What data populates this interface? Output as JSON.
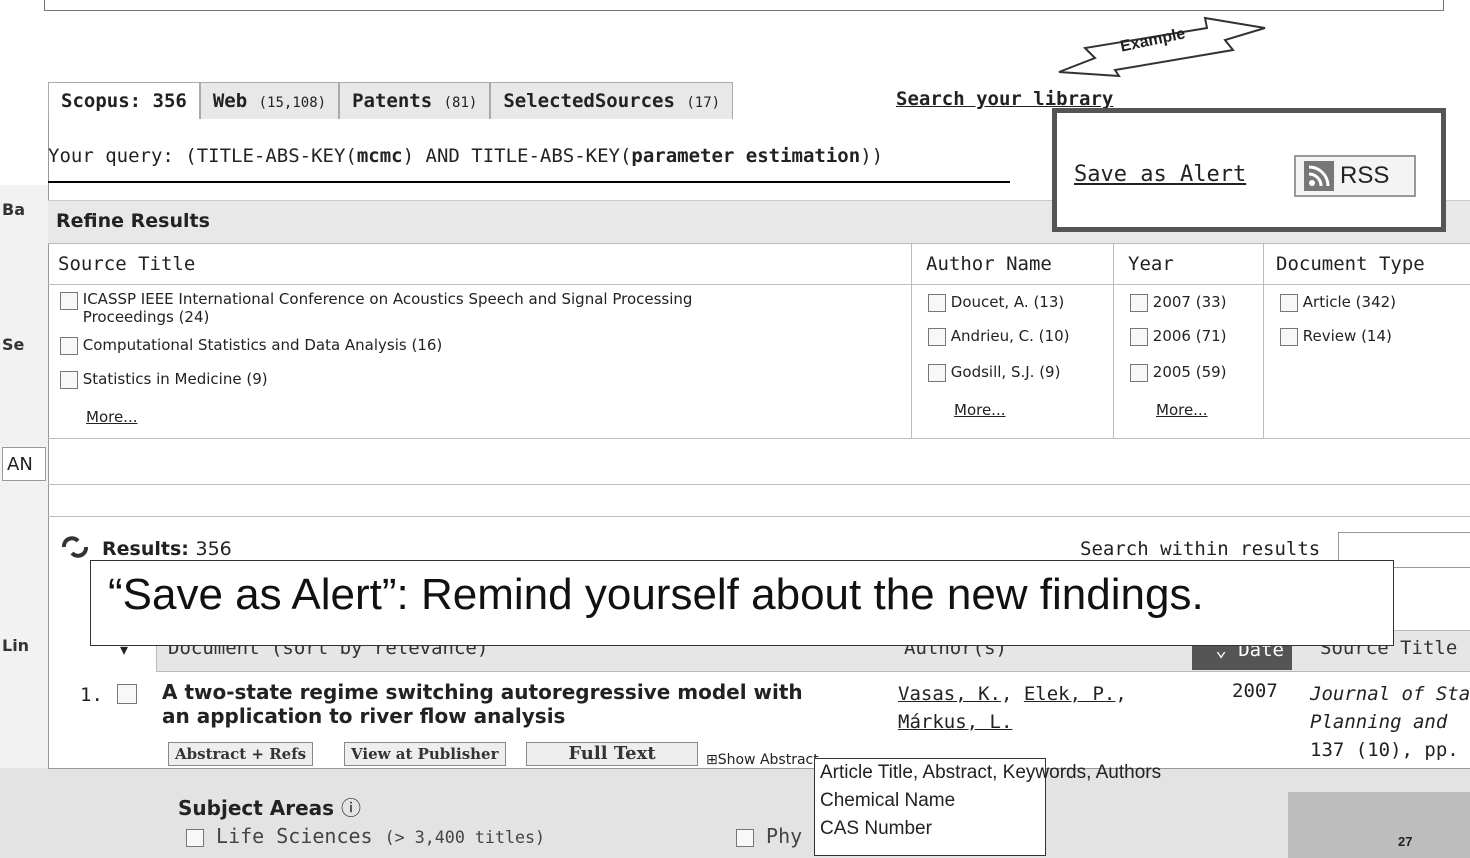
{
  "tabs": [
    {
      "label": "Scopus: 356",
      "count": ""
    },
    {
      "label": "Web",
      "count": "(15,108)"
    },
    {
      "label": "Patents",
      "count": "(81)"
    },
    {
      "label": "SelectedSources",
      "count": "(17)"
    }
  ],
  "search_library": "Search your library",
  "example_banner": "Example",
  "query": {
    "prefix": "Your query: (TITLE-ABS-KEY(",
    "term1": "mcmc",
    "mid": ") AND TITLE-ABS-KEY(",
    "term2": "parameter estimation",
    "suffix": "))"
  },
  "save_alert": "Save as Alert",
  "rss": "RSS",
  "refine_title": "Refine Results",
  "facets": {
    "source_title": {
      "header": "Source Title",
      "items": [
        "ICASSP IEEE International Conference on Acoustics Speech and Signal Processing",
        "Computational Statistics and Data Analysis (16)",
        "Statistics in Medicine (9)"
      ],
      "item0_line2": "Proceedings (24)",
      "more": "More..."
    },
    "author": {
      "header": "Author Name",
      "items": [
        "Doucet, A. (13)",
        "Andrieu, C. (10)",
        "Godsill, S.J. (9)"
      ],
      "more": "More..."
    },
    "year": {
      "header": "Year",
      "items": [
        "2007 (33)",
        "2006 (71)",
        "2005 (59)"
      ],
      "more": "More..."
    },
    "doctype": {
      "header": "Document Type",
      "items": [
        "Article (342)",
        "Review (14)"
      ]
    }
  },
  "results": {
    "label": "Results:",
    "count": "356",
    "search_within": "Search within results"
  },
  "callout": "“Save as Alert”: Remind yourself about the new findings.",
  "table": {
    "doc_header": "Document (sort by relevance)",
    "author_header": "Author(s)",
    "date_header": "Date",
    "source_header": "Source Title"
  },
  "result1": {
    "num": "1.",
    "title_line1": "A two-state regime switching autoregressive model with",
    "title_line2": "an application to river flow analysis",
    "authors": [
      "Vasas, K.",
      "Elek, P.",
      "Márkus, L."
    ],
    "year": "2007",
    "source_line1": "Journal of Sta",
    "source_line2": "Planning and",
    "source_line3": "137 (10), pp.",
    "btn_abstract": "Abstract + Refs",
    "btn_publisher": "View at Publisher",
    "btn_fulltext": "Full Text",
    "show_abstract": "Show Abstract"
  },
  "background": {
    "ba": "Ba",
    "se": "Se",
    "an": "AN",
    "lin": "Lin",
    "subject_areas": "Subject Areas",
    "life_sciences": "Life Sciences",
    "life_count": "(> 3,400 titles)",
    "phys": "Phy",
    "page_number": "27"
  },
  "dropdown": [
    "Article Title, Abstract, Keywords, Authors",
    "Chemical Name",
    "CAS Number"
  ]
}
